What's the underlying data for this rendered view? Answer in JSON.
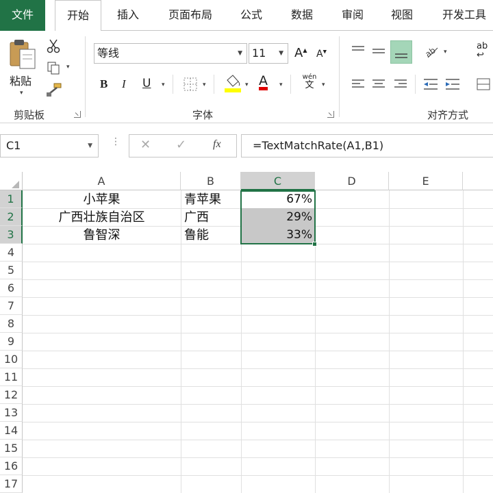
{
  "tabs": [
    "文件",
    "开始",
    "插入",
    "页面布局",
    "公式",
    "数据",
    "审阅",
    "视图",
    "开发工具"
  ],
  "ribbon": {
    "clipboard": {
      "paste_label": "粘贴",
      "group_label": "剪贴板"
    },
    "font": {
      "font_name": "等线",
      "font_size": "11",
      "group_label": "字体",
      "bold": "B",
      "italic": "I",
      "underline": "U",
      "grow": "A",
      "shrink": "A",
      "phonetic_top": "wén",
      "phonetic_bottom": "文",
      "font_color_letter": "A",
      "highlight_color": "#ffff00",
      "font_color": "#e00000"
    },
    "alignment": {
      "group_label": "对齐方式",
      "wrap_label": "ab"
    }
  },
  "formula_bar": {
    "name_box": "C1",
    "fx": "fx",
    "formula": "=TextMatchRate(A1,B1)"
  },
  "sheet": {
    "columns": [
      "A",
      "B",
      "C",
      "D",
      "E"
    ],
    "rows": [
      "1",
      "2",
      "3",
      "4",
      "5",
      "6",
      "7",
      "8",
      "9",
      "10",
      "11",
      "12",
      "13",
      "14",
      "15",
      "16",
      "17"
    ],
    "cells": {
      "A1": "小苹果",
      "B1": "青苹果",
      "C1": "67%",
      "A2": "广西壮族自治区",
      "B2": "广西",
      "C2": "29%",
      "A3": "鲁智深",
      "B3": "鲁能",
      "C3": "33%"
    },
    "selected_range": "C1:C3",
    "accent_color": "#217346"
  }
}
